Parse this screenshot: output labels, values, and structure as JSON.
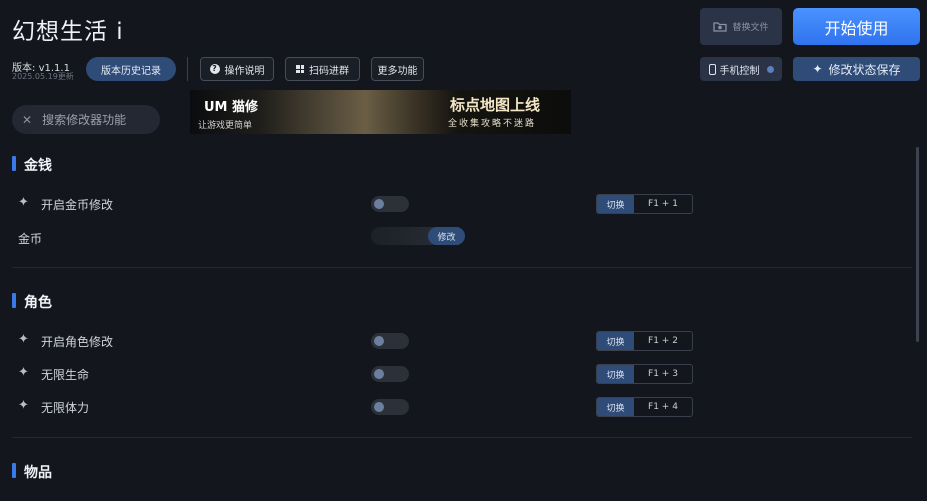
{
  "header": {
    "title": "幻想生活 i",
    "version_label": "版本:",
    "version": "v1.1.1",
    "update_date": "2025.05.19更新",
    "history_button": "版本历史记录",
    "help_button": "操作说明",
    "qr_button": "扫码进群",
    "more_button": "更多功能",
    "replace_file_button": "替换文件",
    "start_button": "开始使用",
    "phone_control_button": "手机控制",
    "save_state_button": "修改状态保存"
  },
  "search": {
    "placeholder": "搜索修改器功能"
  },
  "banner": {
    "logo_text": "猫修",
    "logo_sub": "让游戏更简单",
    "title": "标点地图上线",
    "subtitle": "全收集攻略不迷路"
  },
  "sections": [
    {
      "title": "金钱",
      "rows": [
        {
          "label": "开启金币修改",
          "kind": "toggle",
          "hotkey_action": "切换",
          "hotkey": "F1 + 1"
        },
        {
          "label": "金币",
          "kind": "input",
          "button": "修改"
        }
      ]
    },
    {
      "title": "角色",
      "rows": [
        {
          "label": "开启角色修改",
          "kind": "toggle",
          "hotkey_action": "切换",
          "hotkey": "F1 + 2"
        },
        {
          "label": "无限生命",
          "kind": "toggle",
          "hotkey_action": "切换",
          "hotkey": "F1 + 3"
        },
        {
          "label": "无限体力",
          "kind": "toggle",
          "hotkey_action": "切换",
          "hotkey": "F1 + 4"
        }
      ]
    },
    {
      "title": "物品",
      "rows": []
    }
  ],
  "colors": {
    "background": "#13161d",
    "accent": "#3a7ae8",
    "button_fill": "#2f4b78",
    "start_button": "#3b82f6"
  }
}
